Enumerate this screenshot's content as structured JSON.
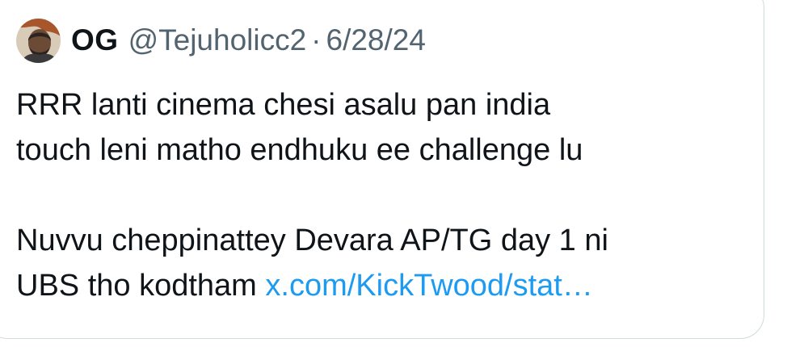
{
  "tweet": {
    "author_name": "OG",
    "handle": "@Tejuholicc2",
    "separator": "·",
    "date": "6/28/24",
    "avatar_icon": "user-avatar",
    "lines": [
      "RRR lanti cinema chesi asalu pan india",
      "touch leni matho endhuku ee challenge lu",
      "Nuvvu cheppinattey Devara AP/TG day 1 ni"
    ],
    "last_line_text": "UBS tho kodtham ",
    "link_text": "x.com/KickTwood/stat…"
  },
  "colors": {
    "text": "#0f1419",
    "secondary": "#536471",
    "link": "#1d9bf0",
    "border": "#cfd9de"
  }
}
